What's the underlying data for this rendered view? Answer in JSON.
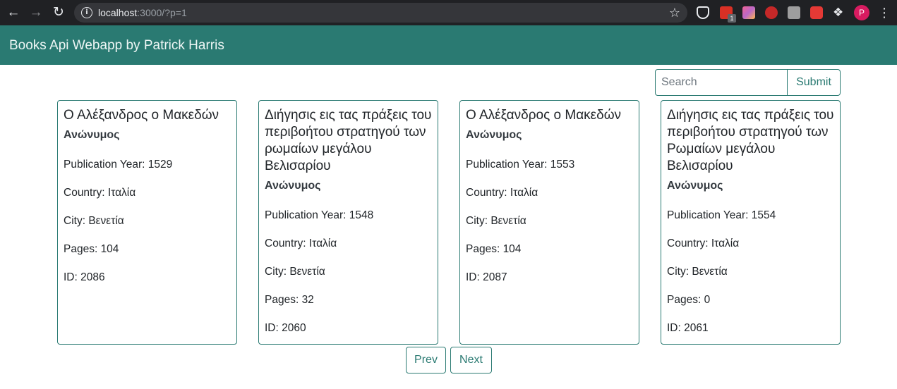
{
  "browser": {
    "url_host": "localhost",
    "url_rest": ":3000/?p=1",
    "extension_badge": "1",
    "avatar_letter": "P"
  },
  "navbar": {
    "brand": "Books Api Webapp by Patrick Harris"
  },
  "search": {
    "placeholder": "Search",
    "submit_label": "Submit"
  },
  "labels": {
    "publication_year": "Publication Year: ",
    "country": "Country: ",
    "city": "City: ",
    "pages": "Pages: ",
    "id": "ID: "
  },
  "books": [
    {
      "title": "Ο Αλέξανδρος ο Μακεδών",
      "author": "Ανώνυμος",
      "year": "1529",
      "country": "Ιταλία",
      "city": "Βενετία",
      "pages": "104",
      "id": "2086"
    },
    {
      "title": "Διήγησις εις τας πράξεις του περιβοήτου στρατηγού των ρωμαίων μεγάλου Βελισαρίου",
      "author": "Ανώνυμος",
      "year": "1548",
      "country": "Ιταλία",
      "city": "Βενετία",
      "pages": "32",
      "id": "2060"
    },
    {
      "title": "Ο Αλέξανδρος ο Μακεδών",
      "author": "Ανώνυμος",
      "year": "1553",
      "country": "Ιταλία",
      "city": "Βενετία",
      "pages": "104",
      "id": "2087"
    },
    {
      "title": "Διήγησις εις τας πράξεις του περιβοήτου στρατηγού των Ρωμαίων μεγάλου Βελισαρίου",
      "author": "Ανώνυμος",
      "year": "1554",
      "country": "Ιταλία",
      "city": "Βενετία",
      "pages": "0",
      "id": "2061"
    }
  ],
  "pagination": {
    "prev_label": "Prev",
    "next_label": "Next"
  },
  "icons": {
    "back": "arrow-left",
    "forward": "arrow-right",
    "reload": "reload",
    "info": "info",
    "bookmark": "star",
    "extensions": "puzzle",
    "menu": "three-dots"
  },
  "colors": {
    "brand": "#2a7a72",
    "chrome": "#202124"
  }
}
